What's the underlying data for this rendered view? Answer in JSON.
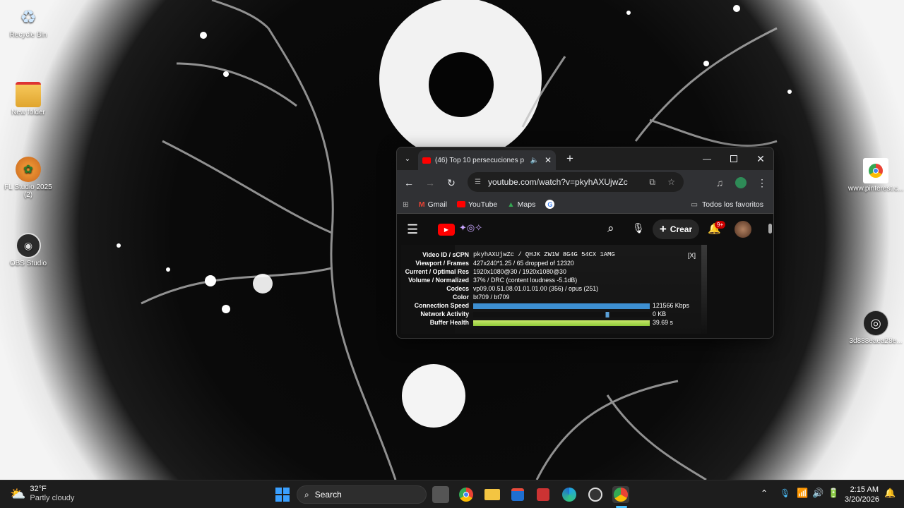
{
  "desktop": {
    "icons": [
      {
        "label": "Recycle Bin",
        "icon": "recycle-bin-icon"
      },
      {
        "label": "New folder",
        "icon": "folder-icon"
      },
      {
        "label": "FL Studio 2025 (2)",
        "icon": "fl-studio-icon"
      },
      {
        "label": "OBS Studio",
        "icon": "obs-icon"
      },
      {
        "label": "www.pinterest.c...",
        "icon": "chrome-icon"
      },
      {
        "label": "3d888eaea28e...",
        "icon": "file-icon"
      }
    ]
  },
  "browser": {
    "tab_title": "(46) Top 10 persecuciones p",
    "url": "youtube.com/watch?v=pkyhAXUjwZc",
    "bookmarks": [
      "Gmail",
      "YouTube",
      "Maps"
    ],
    "all_bookmarks": "Todos los favoritos",
    "youtube": {
      "create_label": "Crear",
      "notification_badge": "9+",
      "close_stats": "[X]",
      "stats": [
        {
          "key": "Video ID / sCPN",
          "value": "pkyhAXUjwZc / QHJK ZW1W 8G4G 54CX 1AMG"
        },
        {
          "key": "Viewport / Frames",
          "value": "427x240*1.25 / 65 dropped of 12320"
        },
        {
          "key": "Current / Optimal Res",
          "value": "1920x1080@30 / 1920x1080@30"
        },
        {
          "key": "Volume / Normalized",
          "value": "37% / DRC (content loudness -5.1dB)"
        },
        {
          "key": "Codecs",
          "value": "vp09.00.51.08.01.01.01.00 (356) / opus (251)"
        },
        {
          "key": "Color",
          "value": "bt709 / bt709"
        },
        {
          "key": "Connection Speed",
          "value": "121566 Kbps"
        },
        {
          "key": "Network Activity",
          "value": "0 KB"
        },
        {
          "key": "Buffer Health",
          "value": "39.69 s"
        }
      ]
    }
  },
  "taskbar": {
    "weather_temp": "32°F",
    "weather_desc": "Partly cloudy",
    "search_label": "Search",
    "time": "2:15 AM",
    "date": "3/20/2026"
  },
  "colors": {
    "accent": "#0078d4",
    "youtube_red": "#ff0000",
    "chrome_tab": "#303134"
  }
}
